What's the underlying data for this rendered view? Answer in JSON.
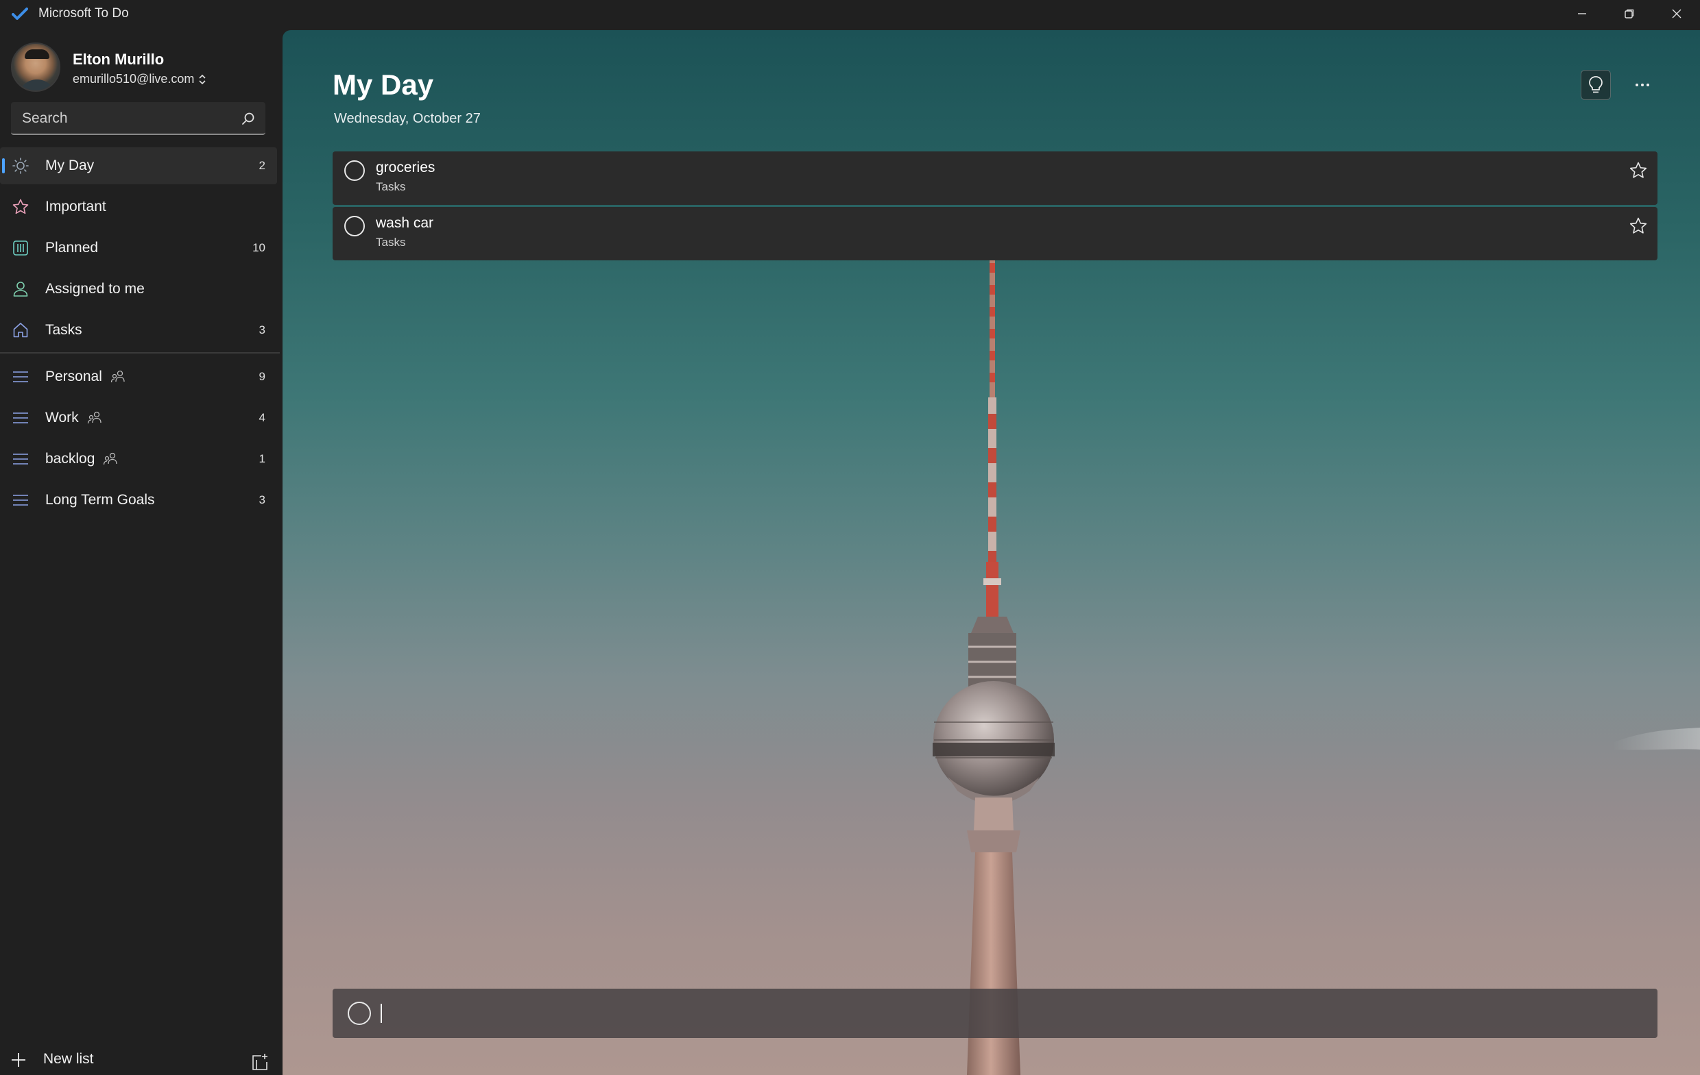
{
  "window": {
    "title": "Microsoft To Do",
    "accent": "#4da3ff"
  },
  "profile": {
    "name": "Elton Murillo",
    "email": "emurillo510@live.com"
  },
  "search": {
    "placeholder": "Search"
  },
  "sidebar": {
    "smart_lists": [
      {
        "label": "My Day",
        "count": "2",
        "icon": "sun-icon",
        "active": true
      },
      {
        "label": "Important",
        "count": "",
        "icon": "star-icon"
      },
      {
        "label": "Planned",
        "count": "10",
        "icon": "calendar-icon"
      },
      {
        "label": "Assigned to me",
        "count": "",
        "icon": "person-icon"
      },
      {
        "label": "Tasks",
        "count": "3",
        "icon": "home-icon"
      }
    ],
    "lists": [
      {
        "label": "Personal",
        "count": "9",
        "shared": true,
        "icon": "list-icon"
      },
      {
        "label": "Work",
        "count": "4",
        "shared": true,
        "icon": "list-icon"
      },
      {
        "label": "backlog",
        "count": "1",
        "shared": true,
        "icon": "list-icon"
      },
      {
        "label": "Long Term Goals",
        "count": "3",
        "shared": false,
        "icon": "list-icon"
      }
    ],
    "new_list_label": "New list"
  },
  "main": {
    "title": "My Day",
    "date": "Wednesday, October 27",
    "tasks": [
      {
        "title": "groceries",
        "list": "Tasks"
      },
      {
        "title": "wash car",
        "list": "Tasks"
      }
    ],
    "add_task_value": ""
  }
}
